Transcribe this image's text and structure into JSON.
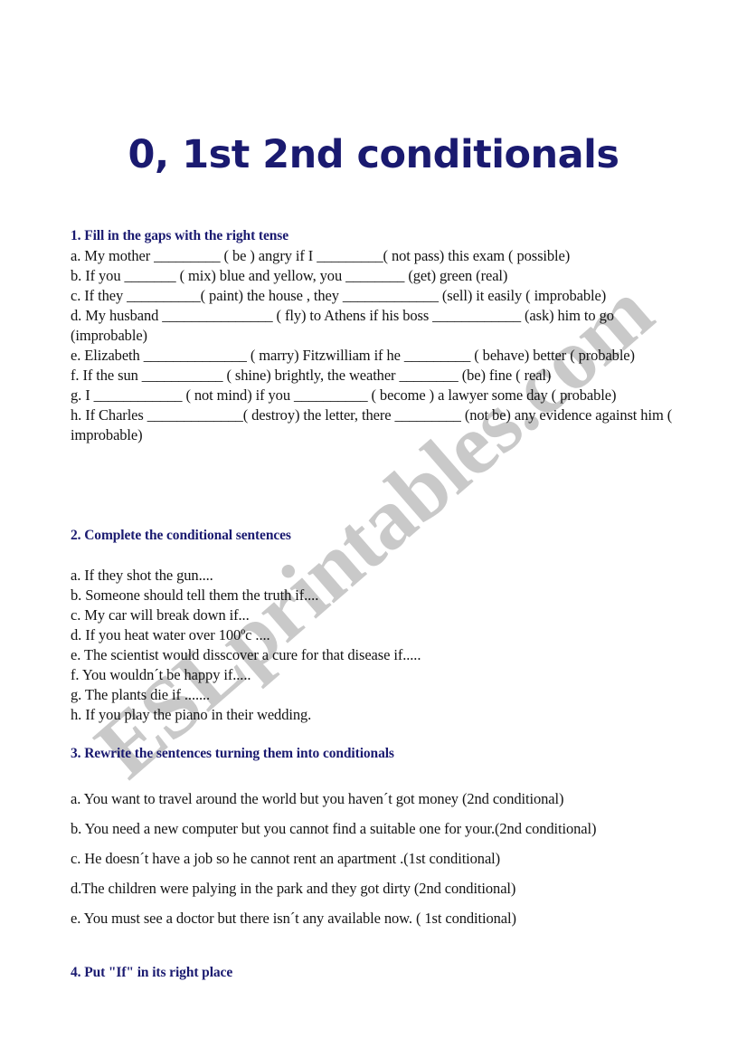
{
  "document": {
    "title": "0, 1st 2nd conditionals",
    "watermark": "ESLprintables.com",
    "accent_color": "#1a1a70",
    "body_color": "#141414",
    "watermark_color": "#c9c9c9",
    "background_color": "#ffffff"
  },
  "sections": [
    {
      "heading": "1. Fill in the gaps with the right tense",
      "items": [
        "a. My mother _________ ( be ) angry if I _________( not pass) this exam ( possible)",
        "b. If you _______ ( mix) blue and yellow, you ________ (get) green (real)",
        "c. If they __________( paint) the house , they _____________ (sell) it easily ( improbable)",
        "d. My husband _______________ ( fly) to Athens if his boss ____________ (ask) him to go (improbable)",
        "e. Elizabeth ______________ ( marry) Fitzwilliam if he _________ ( behave) better ( probable)",
        "f. If the sun ___________ ( shine) brightly, the weather ________ (be) fine ( real)",
        "g. I ____________ ( not mind) if you __________ ( become ) a lawyer some day ( probable)",
        "h. If Charles _____________( destroy) the letter, there _________ (not be) any evidence against him ( improbable)"
      ]
    },
    {
      "heading": "2. Complete the conditional sentences",
      "items": [
        "a. If they shot the gun....",
        "b. Someone should tell them the truth if....",
        "c. My car will break down if...",
        "d. If you heat water over 100ºc ....",
        "e. The scientist would disscover a cure for that disease if.....",
        "f. You wouldn´t be happy if.....",
        "g. The plants die if .......",
        "h. If you  play the piano in their wedding."
      ]
    },
    {
      "heading": "3. Rewrite the sentences turning them into conditionals",
      "items": [
        "a. You want to travel around the world but you haven´t got money  (2nd conditional)",
        "b. You need a new computer but you cannot find a suitable one for your.(2nd conditional)",
        "c. He doesn´t have a job so he cannot rent an apartment .(1st conditional)",
        "d.The children  were palying in the park and they got dirty (2nd conditional)",
        "e. You must see a doctor but there isn´t any available now. ( 1st conditional)"
      ]
    },
    {
      "heading": "4. Put \"If\" in its right place",
      "items": []
    }
  ]
}
